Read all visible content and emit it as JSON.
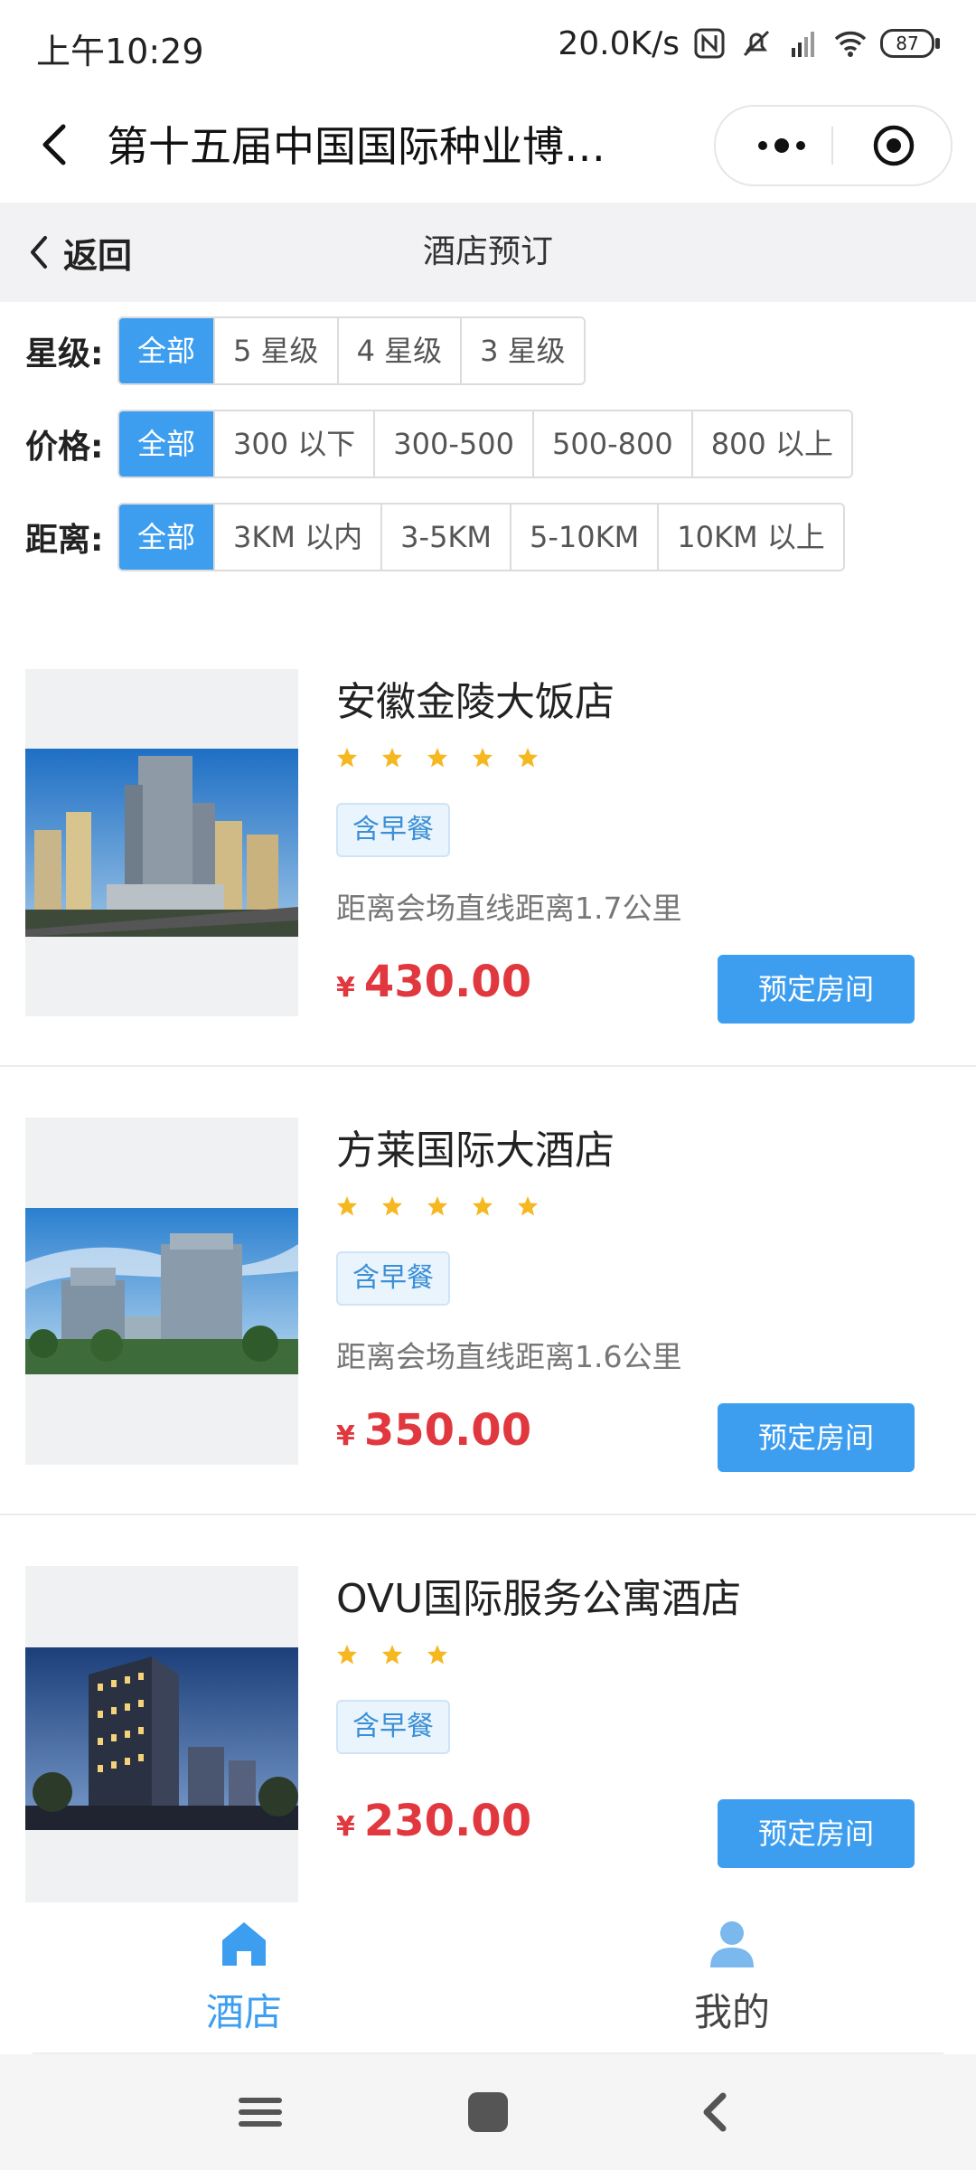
{
  "status_bar": {
    "time": "上午10:29",
    "net_speed": "20.0K/s",
    "battery": "87",
    "icons": [
      "nfc-icon",
      "mute-icon",
      "signal-icon",
      "wifi-icon",
      "battery-icon"
    ]
  },
  "titlebar": {
    "title": "第十五届中国国际种业博…"
  },
  "subheader": {
    "back_label": "返回",
    "title": "酒店预订"
  },
  "filters": {
    "star": {
      "label": "星级:",
      "options": [
        "全部",
        "5 星级",
        "4 星级",
        "3 星级"
      ],
      "selected": "全部"
    },
    "price": {
      "label": "价格:",
      "options": [
        "全部",
        "300 以下",
        "300-500",
        "500-800",
        "800 以上"
      ],
      "selected": "全部"
    },
    "distance": {
      "label": "距离:",
      "options": [
        "全部",
        "3KM 以内",
        "3-5KM",
        "5-10KM",
        "10KM 以上"
      ],
      "selected": "全部"
    }
  },
  "hotels": [
    {
      "name": "安徽金陵大饭店",
      "stars": 5,
      "tag": "含早餐",
      "distance": "距离会场直线距离1.7公里",
      "currency": "¥",
      "price": "430.00",
      "button": "预定房间"
    },
    {
      "name": "方莱国际大酒店",
      "stars": 5,
      "tag": "含早餐",
      "distance": "距离会场直线距离1.6公里",
      "currency": "¥",
      "price": "350.00",
      "button": "预定房间"
    },
    {
      "name": "OVU国际服务公寓酒店",
      "stars": 3,
      "tag": "含早餐",
      "distance": "",
      "currency": "¥",
      "price": "230.00",
      "button": "预定房间"
    }
  ],
  "tabbar": {
    "tabs": [
      {
        "label": "酒店",
        "icon": "home-icon",
        "active": true
      },
      {
        "label": "我的",
        "icon": "user-icon",
        "active": false
      }
    ]
  },
  "colors": {
    "accent": "#3d9ef0",
    "price": "#e0383e",
    "star": "#f5b820",
    "tab_inactive": "#444444"
  }
}
